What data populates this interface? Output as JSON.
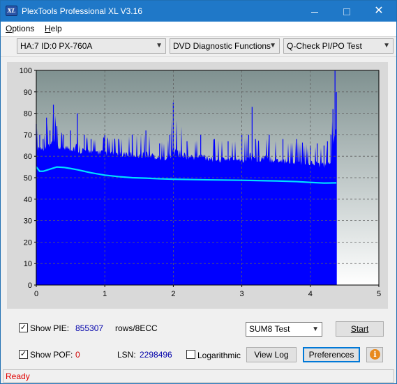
{
  "window": {
    "title": "PlexTools Professional XL V3.16",
    "logo_text": "XL"
  },
  "menu": {
    "items": [
      {
        "accel": "O",
        "rest": "ptions"
      },
      {
        "accel": "H",
        "rest": "elp"
      }
    ]
  },
  "toolbar": {
    "drive": "HA:7 ID:0  PX-760A",
    "function": "DVD Diagnostic Functions",
    "test": "Q-Check PI/PO Test"
  },
  "chart_data": {
    "type": "area",
    "xlim": [
      0,
      5
    ],
    "ylim": [
      0,
      100
    ],
    "x_ticks": [
      "0",
      "1",
      "2",
      "3",
      "4",
      "5"
    ],
    "y_ticks": [
      "0",
      "10",
      "20",
      "30",
      "40",
      "50",
      "60",
      "70",
      "80",
      "90",
      "100"
    ],
    "grid": true,
    "series": [
      {
        "kind": "bars",
        "color": "#0000ff",
        "x": [
          0.0,
          0.05,
          0.1,
          0.15,
          0.2,
          0.25,
          0.3,
          0.4,
          0.5,
          0.6,
          0.7,
          0.8,
          1.0,
          1.2,
          1.4,
          1.6,
          1.8,
          1.95,
          2.0,
          2.2,
          2.4,
          2.6,
          2.8,
          3.0,
          3.1,
          3.15,
          3.2,
          3.4,
          3.6,
          3.8,
          4.0,
          4.1,
          4.2,
          4.25,
          4.3,
          4.33,
          4.36,
          4.38
        ],
        "max": [
          75,
          70,
          68,
          78,
          72,
          84,
          74,
          70,
          72,
          80,
          70,
          68,
          70,
          68,
          70,
          72,
          66,
          70,
          85,
          67,
          70,
          68,
          67,
          70,
          70,
          83,
          68,
          70,
          68,
          68,
          65,
          66,
          65,
          67,
          70,
          82,
          100,
          90
        ],
        "base": [
          62,
          63,
          62,
          64,
          63,
          64,
          62,
          63,
          62,
          61,
          61,
          61,
          60,
          60,
          59,
          59,
          58,
          58,
          59,
          58,
          58,
          57,
          57,
          57,
          57,
          57,
          57,
          57,
          56,
          56,
          55,
          55,
          54,
          54,
          55,
          60,
          72,
          70
        ]
      },
      {
        "kind": "line",
        "color": "#00e0ff",
        "x": [
          0.0,
          0.05,
          0.1,
          0.2,
          0.3,
          0.4,
          0.5,
          0.6,
          0.7,
          0.8,
          1.0,
          1.2,
          1.4,
          1.6,
          1.8,
          2.0,
          2.5,
          3.0,
          3.5,
          3.8,
          4.0,
          4.2,
          4.38
        ],
        "y": [
          55,
          53,
          53,
          54,
          55,
          54.8,
          54.3,
          53.7,
          53,
          52.3,
          51.2,
          50.5,
          50,
          49.8,
          49.5,
          49.3,
          49,
          48.8,
          48.5,
          48.2,
          47.8,
          47.5,
          47.6
        ]
      }
    ],
    "plot_end_x": 4.38
  },
  "controls": {
    "show_pie_label": "Show PIE:",
    "show_pie_checked": true,
    "pie_value": "855307",
    "rows_label": "rows/8ECC",
    "show_pof_label": "Show POF:",
    "show_pof_checked": true,
    "pof_value": "0",
    "lsn_label": "LSN:",
    "lsn_value": "2298496",
    "logarithmic_label": "Logarithmic",
    "logarithmic_checked": false,
    "sum_test": "SUM8 Test",
    "start_label": "Start",
    "view_log_label": "View Log",
    "preferences_label": "Preferences",
    "info_glyph": "i"
  },
  "status": {
    "text": "Ready"
  },
  "colors": {
    "titlebar": "#1f78c8",
    "plot_bg_top": "#7f9190",
    "pie_area": "#0000ff",
    "pof_line": "#00e0ff",
    "status_text": "#e00000",
    "pie_value": "#0000aa",
    "pof_value": "#d00000"
  }
}
